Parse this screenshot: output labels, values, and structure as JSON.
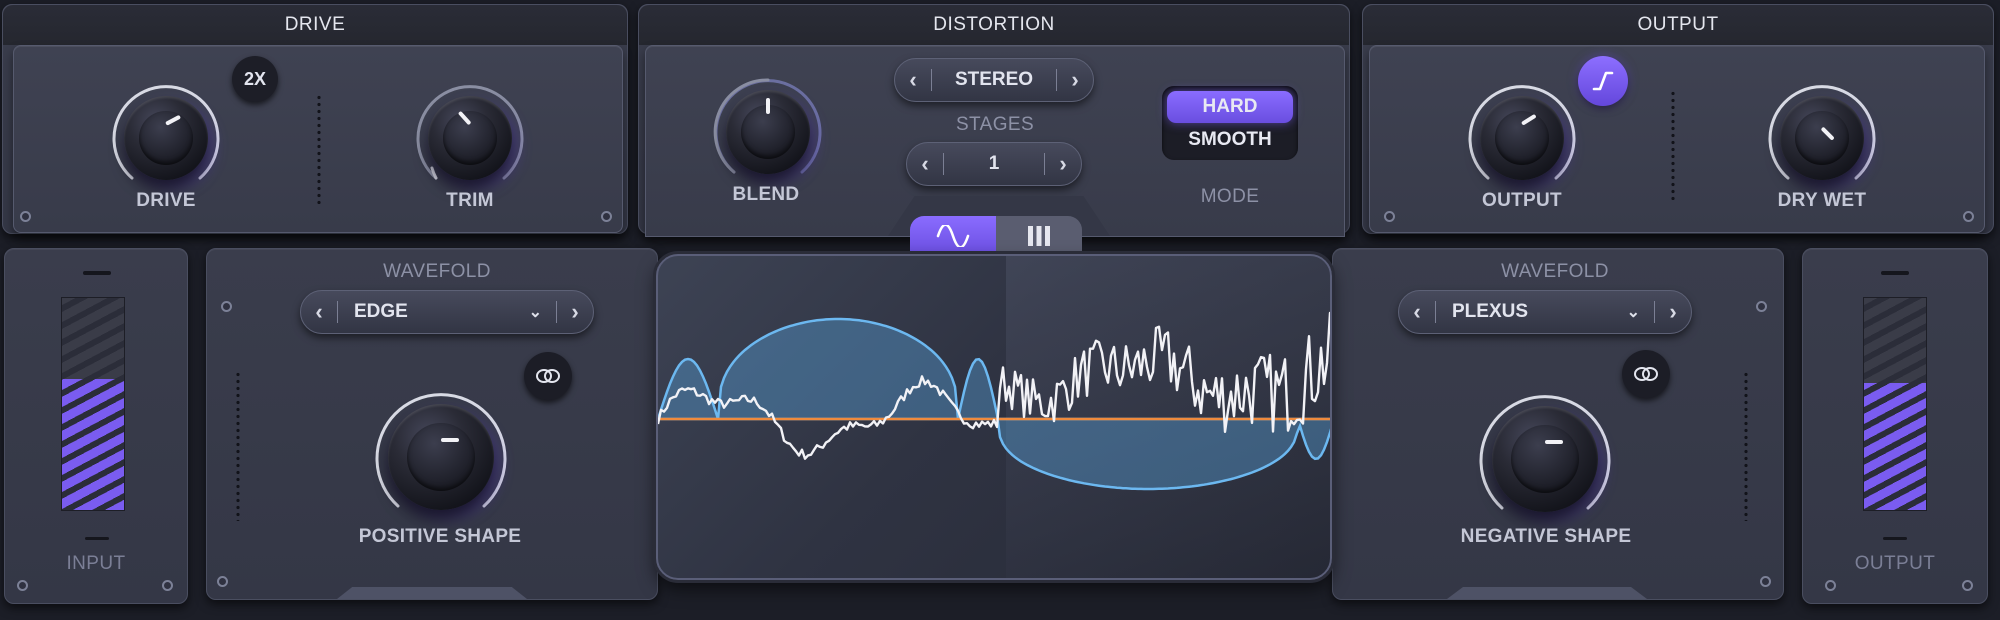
{
  "drive_section": {
    "title": "DRIVE",
    "oversample_label": "2X",
    "drive": {
      "label": "DRIVE",
      "value": 0.72
    },
    "trim": {
      "label": "TRIM",
      "value": 0.32
    }
  },
  "distortion_section": {
    "title": "DISTORTION",
    "blend": {
      "label": "BLEND",
      "value": 0.5
    },
    "channel_mode": "STEREO",
    "stages_label": "STAGES",
    "stages_value": "1",
    "mode_label": "MODE",
    "mode_options": [
      "HARD",
      "SMOOTH"
    ],
    "mode_selected": "HARD"
  },
  "output_section": {
    "title": "OUTPUT",
    "output": {
      "label": "OUTPUT",
      "value": 0.68
    },
    "dry_wet": {
      "label": "DRY WET",
      "value": 0.62
    }
  },
  "wavefold_left": {
    "title": "WAVEFOLD",
    "type": "EDGE",
    "shape": {
      "label": "POSITIVE SHAPE",
      "value": 0.7
    }
  },
  "wavefold_right": {
    "title": "WAVEFOLD",
    "type": "PLEXUS",
    "shape": {
      "label": "NEGATIVE SHAPE",
      "value": 0.7
    }
  },
  "input_meter": {
    "label": "INPUT",
    "level": 0.62
  },
  "output_meter": {
    "label": "OUTPUT",
    "level": 0.6
  },
  "display_tabs": [
    "waveform-icon",
    "bars-icon"
  ],
  "colors": {
    "accent": "#7a5cf0",
    "wave_fill": "#5aa9e6",
    "center_line": "#f08a3c",
    "panel": "#3a3d4c"
  }
}
